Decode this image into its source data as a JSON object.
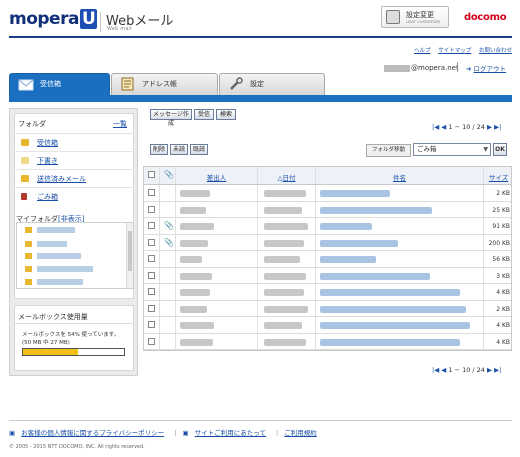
{
  "header": {
    "logo_text": "mopera",
    "logo_u": "U",
    "brand": "Webメール",
    "brand_sub": "Web mail",
    "settings_label": "設定変更",
    "settings_sub": "user customize",
    "carrier": "docomo",
    "links": [
      "ヘルプ",
      "サイトマップ",
      "お問い合わせ"
    ],
    "user_domain": "@mopera.net",
    "logout": "ログアウト"
  },
  "tabs": [
    {
      "label": "受信箱",
      "active": true
    },
    {
      "label": "アドレス帳",
      "active": false
    },
    {
      "label": "設定",
      "active": false
    }
  ],
  "sidebar": {
    "folder_title": "フォルダ",
    "folder_all": "一覧",
    "folders": [
      "受信箱",
      "下書き",
      "送信済みメール",
      "ごみ箱"
    ],
    "myfolder_label": "マイフォルダ",
    "myfolder_toggle": "[非表示]",
    "mailbox_title": "メールボックス使用量",
    "mailbox_line1": "メールボックスを 54% 使っています。",
    "mailbox_line2": "(50 MB 中 27 MB)",
    "mailbox_usage_percent": 54
  },
  "toolbar": {
    "compose": "メッセージ作成",
    "receive": "受信",
    "search": "検索",
    "delete": "削除",
    "unread": "未読",
    "read": "既読",
    "pager": "1 − 10 / 24",
    "folder_move_label": "フォルダ移動",
    "folder_move_value": "ごみ箱",
    "ok": "OK"
  },
  "table": {
    "headers": {
      "from": "差出人",
      "date": "日付",
      "subject": "件名",
      "size": "サイズ"
    },
    "rows": [
      {
        "clip": false,
        "size": "2 KB"
      },
      {
        "clip": false,
        "size": "25 KB"
      },
      {
        "clip": true,
        "size": "91 KB"
      },
      {
        "clip": true,
        "size": "200 KB"
      },
      {
        "clip": false,
        "size": "56 KB"
      },
      {
        "clip": false,
        "size": "3 KB"
      },
      {
        "clip": false,
        "size": "4 KB"
      },
      {
        "clip": false,
        "size": "2 KB"
      },
      {
        "clip": false,
        "size": "4 KB"
      },
      {
        "clip": false,
        "size": "4 KB"
      }
    ]
  },
  "footer": {
    "privacy": "お客様の個人情報に関するプライバシーポリシー",
    "site_usage": "サイトご利用にあたって",
    "terms": "ご利用規約",
    "copyright": "© 2005 - 2015 NTT DOCOMO, INC. All rights reserved."
  }
}
